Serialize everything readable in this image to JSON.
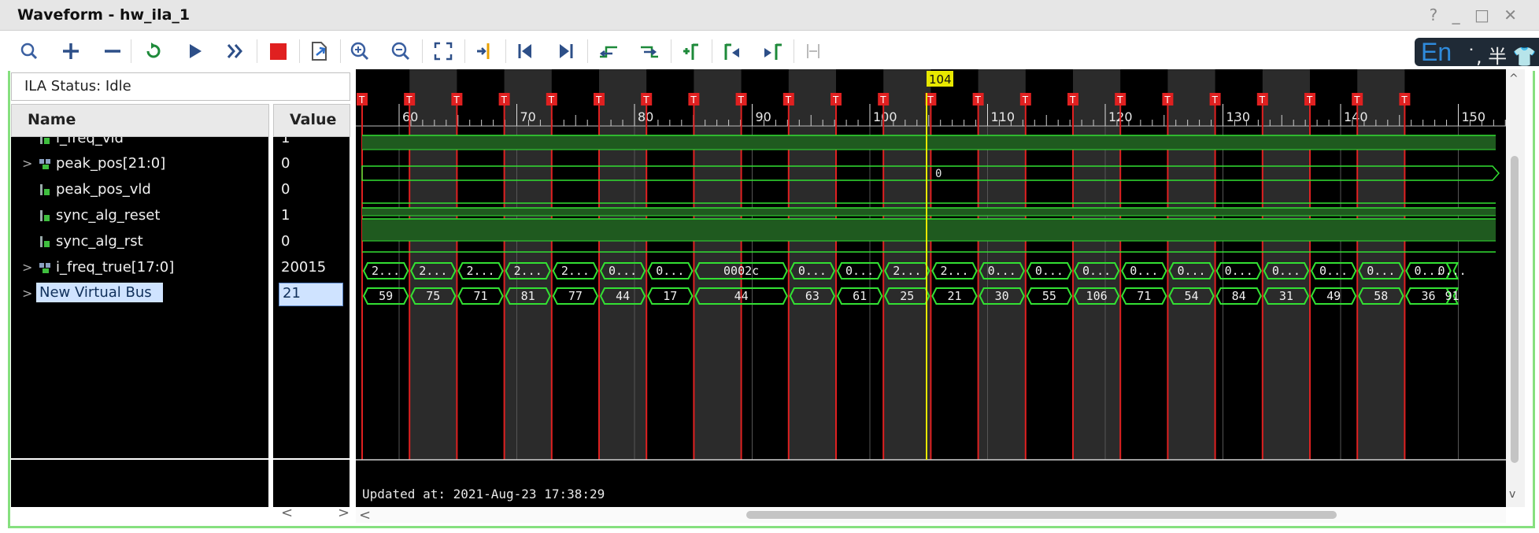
{
  "window": {
    "title": "Waveform - hw_ila_1",
    "controls": [
      "?",
      "_",
      "□",
      "✕"
    ]
  },
  "toolbar": {
    "buttons": [
      {
        "icon": "search-icon"
      },
      {
        "icon": "plus-icon"
      },
      {
        "icon": "minus-icon"
      },
      {
        "icon": "run-trigger-immediate-icon"
      },
      {
        "icon": "run-trigger-icon"
      },
      {
        "icon": "auto-rerun-icon"
      },
      {
        "icon": "stop-icon"
      },
      {
        "icon": "export-icon"
      },
      {
        "icon": "zoom-in-icon"
      },
      {
        "icon": "zoom-out-icon"
      },
      {
        "icon": "zoom-fit-icon"
      },
      {
        "icon": "go-to-cursor-icon"
      },
      {
        "icon": "go-to-time-zero-icon"
      },
      {
        "icon": "go-to-last-time-icon"
      },
      {
        "icon": "previous-transition-icon"
      },
      {
        "icon": "next-transition-icon"
      },
      {
        "icon": "add-marker-icon"
      },
      {
        "icon": "previous-marker-icon"
      },
      {
        "icon": "next-marker-icon"
      },
      {
        "icon": "swap-cursors-icon"
      }
    ]
  },
  "ime": {
    "lang": "En",
    "rest": "˙, 半 👕"
  },
  "status": {
    "text": "ILA Status: Idle"
  },
  "columns": {
    "name": "Name",
    "value": "Value"
  },
  "signals": [
    {
      "name": "i_freq_vld",
      "value": "1",
      "type": "bit",
      "expandable": false
    },
    {
      "name": "peak_pos[21:0]",
      "value": "0",
      "type": "bus",
      "expandable": true
    },
    {
      "name": "peak_pos_vld",
      "value": "0",
      "type": "bit",
      "expandable": false
    },
    {
      "name": "sync_alg_reset",
      "value": "1",
      "type": "bit",
      "expandable": false
    },
    {
      "name": "sync_alg_rst",
      "value": "0",
      "type": "bit",
      "expandable": false
    },
    {
      "name": "i_freq_true[17:0]",
      "value": "20015",
      "type": "bus",
      "expandable": true
    },
    {
      "name": "New Virtual Bus",
      "value": "21",
      "type": "vbus",
      "expandable": true,
      "selected": true
    }
  ],
  "waveform": {
    "cursor_label": "104",
    "trigger_label": "T",
    "time_ticks": [
      "60",
      "70",
      "80",
      "90",
      "100",
      "110",
      "120",
      "130",
      "140",
      "150"
    ],
    "peak_pos_value": "0",
    "i_freq_true_values": [
      "2...",
      "2...",
      "2...",
      "2...",
      "2...",
      "0...",
      "0...",
      "0002c",
      "0...",
      "0...",
      "2...",
      "2...",
      "0...",
      "0...",
      "0...",
      "0...",
      "0...",
      "0...",
      "0...",
      "0...",
      "0...",
      "0...",
      "0..."
    ],
    "virtual_bus_values": [
      "59",
      "75",
      "71",
      "81",
      "77",
      "44",
      "17",
      "44",
      "63",
      "61",
      "25",
      "21",
      "30",
      "55",
      "106",
      "71",
      "54",
      "84",
      "31",
      "49",
      "58",
      "36",
      "91"
    ],
    "updated_text": "Updated at: 2021-Aug-23 17:38:29"
  },
  "colors": {
    "wave_green": "#33e033",
    "bit_fill": "#1f5a1f",
    "trigger_red": "#e02020",
    "cursor_yellow": "#e8e800",
    "shade_band": "#2b2b2b",
    "frame_border": "#86e07f"
  }
}
